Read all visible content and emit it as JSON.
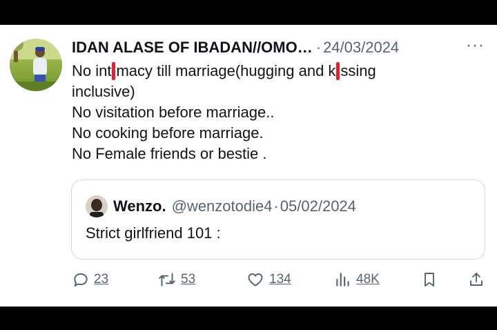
{
  "tweet": {
    "author_name": "IDAN ALASE OF IBADAN//OMO…",
    "separator": "·",
    "date": "24/03/2024",
    "more_label": "···",
    "line1_a": "No int",
    "line1_b": "macy till marriage(hugging and k",
    "line1_c": "ssing",
    "line2": "inclusive)",
    "line3": "No visitation before marriage..",
    "line4": "No cooking before marriage.",
    "line5": "No Female friends or bestie ."
  },
  "quoted": {
    "name": "Wenzo.",
    "handle": "@wenzotodie4",
    "separator": "·",
    "date": "05/02/2024",
    "text": "Strict girlfriend 101 :"
  },
  "actions": {
    "replies": "23",
    "reposts": "53",
    "likes": "134",
    "views": "48K",
    "reply_icon": "reply-icon",
    "repost_icon": "repost-icon",
    "like_icon": "heart-icon",
    "views_icon": "views-icon",
    "bookmark_icon": "bookmark-icon",
    "share_icon": "share-icon"
  },
  "colors": {
    "text": "#0f1419",
    "muted": "#536471",
    "border": "#cfd9de",
    "cursor_marker": "#e0232a"
  }
}
